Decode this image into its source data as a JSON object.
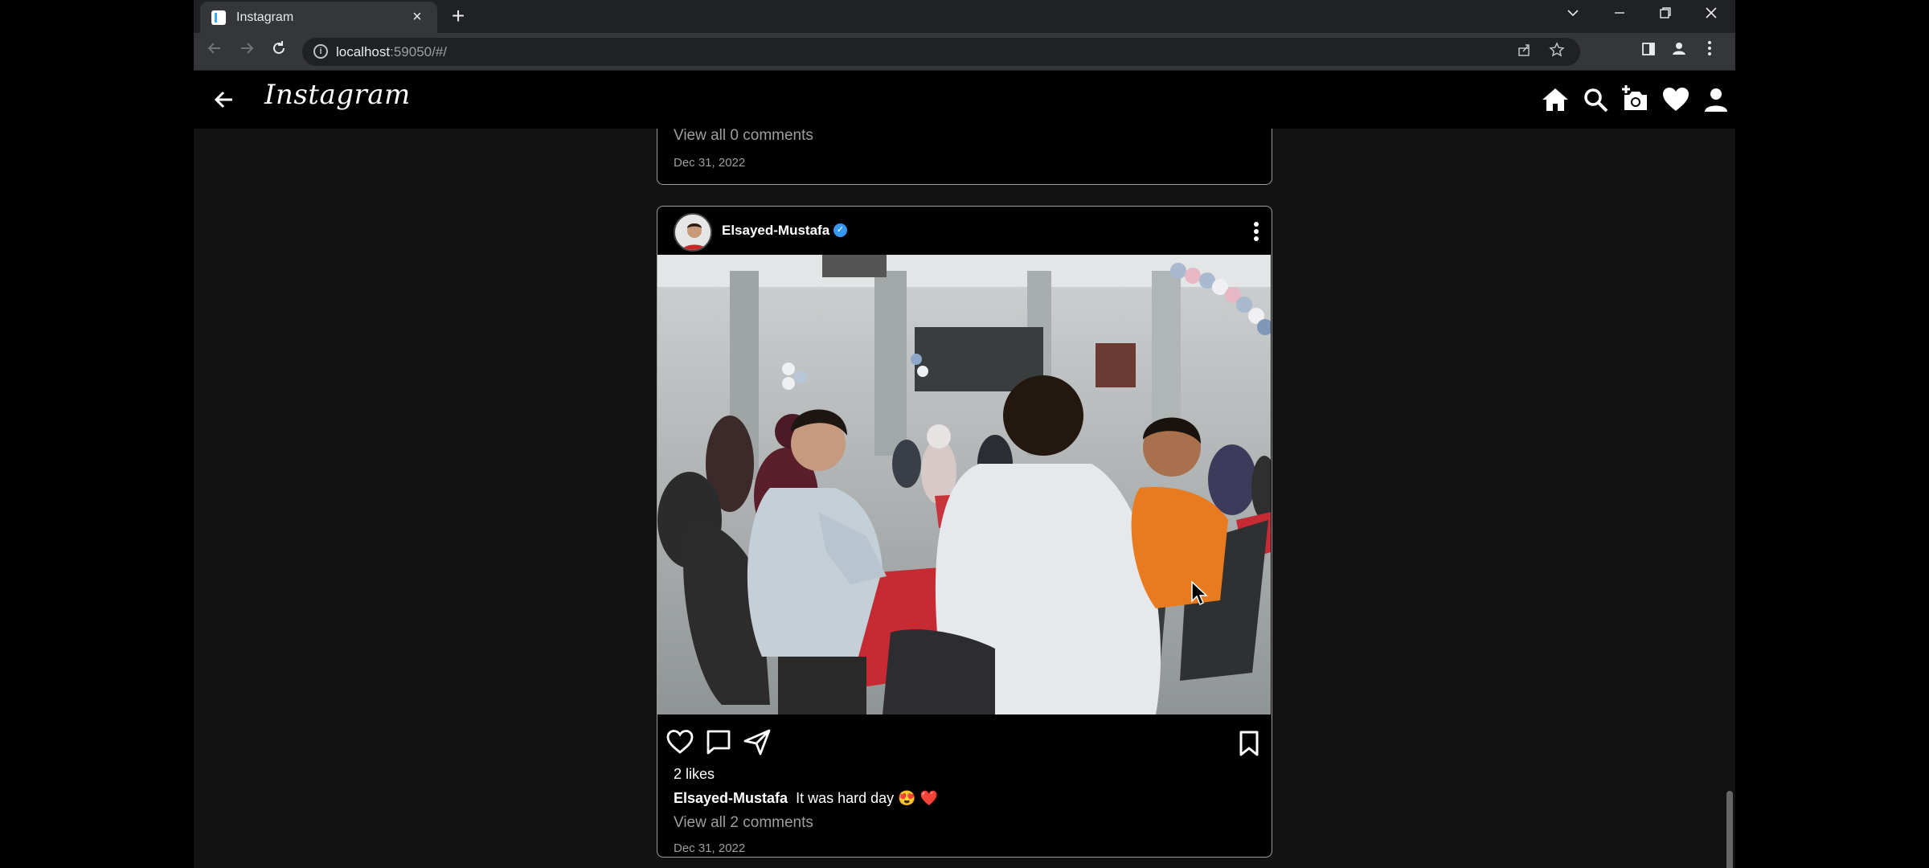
{
  "browser": {
    "tab_title": "Instagram",
    "url_host": "localhost",
    "url_rest": ":59050/#/"
  },
  "app": {
    "logo": "Instagram"
  },
  "previous_post": {
    "view_comments": "View all 0 comments",
    "date": "Dec 31, 2022"
  },
  "post": {
    "username": "Elsayed-Mustafa",
    "likes": "2 likes",
    "caption_user": "Elsayed-Mustafa",
    "caption_text": "It was hard day 😍 ❤️",
    "view_comments": "View all 2 comments",
    "date": "Dec 31, 2022"
  },
  "colors": {
    "chrome_dark": "#202124",
    "chrome_toolbar": "#35363a",
    "verified_blue": "#3897f0",
    "muted": "#9e9e9e"
  }
}
